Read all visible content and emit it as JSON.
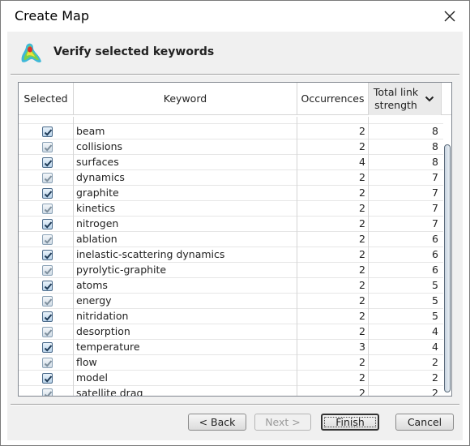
{
  "window": {
    "title": "Create Map"
  },
  "header": {
    "title": "Verify selected keywords"
  },
  "table": {
    "columns": {
      "selected": "Selected",
      "keyword": "Keyword",
      "occurrences": "Occurrences",
      "link_strength": "Total link strength"
    },
    "rows": [
      {
        "keyword": "beam",
        "occurrences": "2",
        "link_strength": "8"
      },
      {
        "keyword": "collisions",
        "occurrences": "2",
        "link_strength": "8"
      },
      {
        "keyword": "surfaces",
        "occurrences": "4",
        "link_strength": "8"
      },
      {
        "keyword": "dynamics",
        "occurrences": "2",
        "link_strength": "7"
      },
      {
        "keyword": "graphite",
        "occurrences": "2",
        "link_strength": "7"
      },
      {
        "keyword": "kinetics",
        "occurrences": "2",
        "link_strength": "7"
      },
      {
        "keyword": "nitrogen",
        "occurrences": "2",
        "link_strength": "7"
      },
      {
        "keyword": "ablation",
        "occurrences": "2",
        "link_strength": "6"
      },
      {
        "keyword": "inelastic-scattering dynamics",
        "occurrences": "2",
        "link_strength": "6"
      },
      {
        "keyword": "pyrolytic-graphite",
        "occurrences": "2",
        "link_strength": "6"
      },
      {
        "keyword": "atoms",
        "occurrences": "2",
        "link_strength": "5"
      },
      {
        "keyword": "energy",
        "occurrences": "2",
        "link_strength": "5"
      },
      {
        "keyword": "nitridation",
        "occurrences": "2",
        "link_strength": "5"
      },
      {
        "keyword": "desorption",
        "occurrences": "2",
        "link_strength": "4"
      },
      {
        "keyword": "temperature",
        "occurrences": "3",
        "link_strength": "4"
      },
      {
        "keyword": "flow",
        "occurrences": "2",
        "link_strength": "2"
      },
      {
        "keyword": "model",
        "occurrences": "2",
        "link_strength": "2"
      },
      {
        "keyword": "satellite drag",
        "occurrences": "2",
        "link_strength": "2"
      }
    ]
  },
  "buttons": {
    "back": "< Back",
    "next": "Next >",
    "finish": "Finish",
    "cancel": "Cancel"
  },
  "icons": {
    "close": "close-icon",
    "header": "density-map-icon",
    "sort": "chevron-down-icon",
    "checkbox": "checkmark-icon"
  },
  "colors": {
    "checkbox_border": "#4a6a8a",
    "sorted_header_bg": "#eaeaea"
  }
}
